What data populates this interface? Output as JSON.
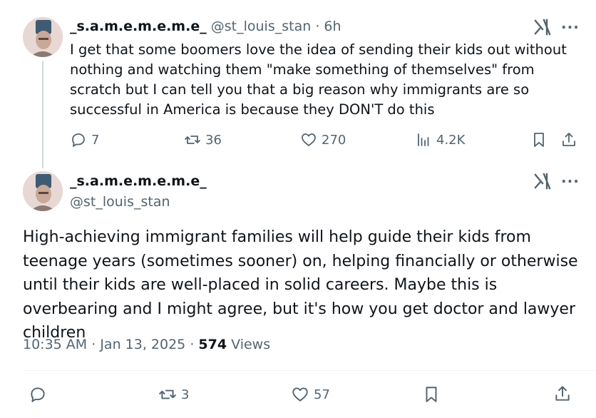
{
  "tweet1": {
    "display_name": "_s.a.m.e.m.e.m.e_",
    "handle": "@st_louis_stan",
    "separator": "·",
    "time": "6h",
    "text": "I get that some boomers love the idea of sending their kids out without nothing and watching them \"make something of themselves\" from scratch but I can tell you that a big reason why immigrants are so successful in America is because they DON'T do this",
    "replies": "7",
    "reposts": "36",
    "likes": "270",
    "views": "4.2K"
  },
  "tweet2": {
    "display_name": "_s.a.m.e.m.e.m.e_",
    "handle": "@st_louis_stan",
    "text": "High-achieving immigrant families will help guide their kids from teenage years (sometimes sooner) on, helping financially or otherwise until their kids are well-placed in solid careers. Maybe this is overbearing and I might agree, but it's how you get doctor and lawyer children",
    "time": "10:35 AM",
    "date": "Jan 13, 2025",
    "separator": "·",
    "views_count": "574",
    "views_label": "Views",
    "reposts": "3",
    "likes": "57"
  },
  "icons": {
    "grok": "grok-icon",
    "more": "more-icon",
    "reply": "reply-icon",
    "repost": "repost-icon",
    "like": "like-icon",
    "views": "views-icon",
    "bookmark": "bookmark-icon",
    "share": "share-icon"
  },
  "colors": {
    "text": "#0f1419",
    "secondary": "#536471",
    "thread_line": "#cfd9de"
  }
}
